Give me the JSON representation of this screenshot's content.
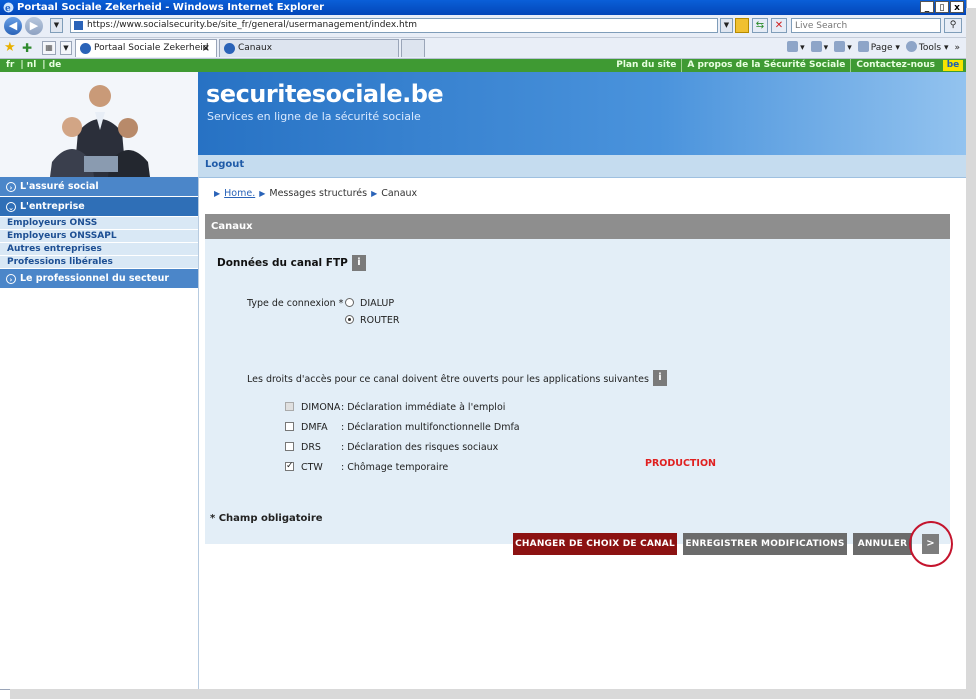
{
  "window": {
    "title": "Portaal Sociale Zekerheid - Windows Internet Explorer",
    "buttons": [
      "_",
      "▯",
      "x"
    ]
  },
  "addressbar": {
    "url": "https://www.socialsecurity.be/site_fr/general/usermanagement/index.htm",
    "search_placeholder": "Live Search"
  },
  "tabs": [
    {
      "label": "Portaal Sociale Zekerheid",
      "active": true
    },
    {
      "label": "Canaux",
      "active": false
    }
  ],
  "toolbar_right": {
    "page": "Page",
    "tools": "Tools",
    "more": "»"
  },
  "greenbar": {
    "languages": [
      "fr",
      "nl",
      "de"
    ],
    "links": [
      "Plan du site",
      "A propos de la Sécurité Sociale",
      "Contactez-nous"
    ],
    "logo": "be"
  },
  "header": {
    "brand": "securitesociale.be",
    "tagline": "Services en ligne de la sécurité sociale",
    "logout": "Logout"
  },
  "sidebar": {
    "sections": [
      {
        "label": "L'assuré social",
        "items": []
      },
      {
        "label": "L'entreprise",
        "items": [
          "Employeurs ONSS",
          "Employeurs ONSSAPL",
          "Autres entreprises",
          "Professions libérales"
        ]
      },
      {
        "label": "Le professionnel du secteur social",
        "items": []
      }
    ]
  },
  "breadcrumb": [
    "Home.",
    "Messages structurés",
    "Canaux"
  ],
  "panel": {
    "title": "Canaux",
    "section_title": "Données du canal FTP :",
    "info_glyph": "i",
    "connection_label": "Type de connexion * :",
    "connection_options": [
      {
        "label": "DIALUP",
        "selected": false
      },
      {
        "label": "ROUTER",
        "selected": true
      }
    ],
    "rights_text": "Les droits d'accès pour ce canal doivent être ouverts pour les applications suivantes :",
    "applications": [
      {
        "code": "DIMONA",
        "desc": ": Déclaration immédiate à l'emploi",
        "checked": false,
        "disabled": true
      },
      {
        "code": "DMFA",
        "desc": ": Déclaration multifonctionnelle Dmfa",
        "checked": false,
        "disabled": false
      },
      {
        "code": "DRS",
        "desc": ": Déclaration des risques sociaux",
        "checked": false,
        "disabled": false
      },
      {
        "code": "CTW",
        "desc": ": Chômage temporaire",
        "checked": true,
        "disabled": false
      }
    ],
    "production_label": "PRODUCTION",
    "required_note": "* Champ obligatoire"
  },
  "actions": {
    "change_channel": "CHANGER DE CHOIX DE CANAL",
    "save": "ENREGISTRER MODIFICATIONS",
    "cancel": "ANNULER",
    "next": ">"
  },
  "colors": {
    "green": "#3f9a33",
    "blue_banner": "#2772c4",
    "panel_bg": "#e3eef7",
    "red_button": "#8c1212",
    "production": "#e02020",
    "annotation_circle": "#c4142d"
  }
}
